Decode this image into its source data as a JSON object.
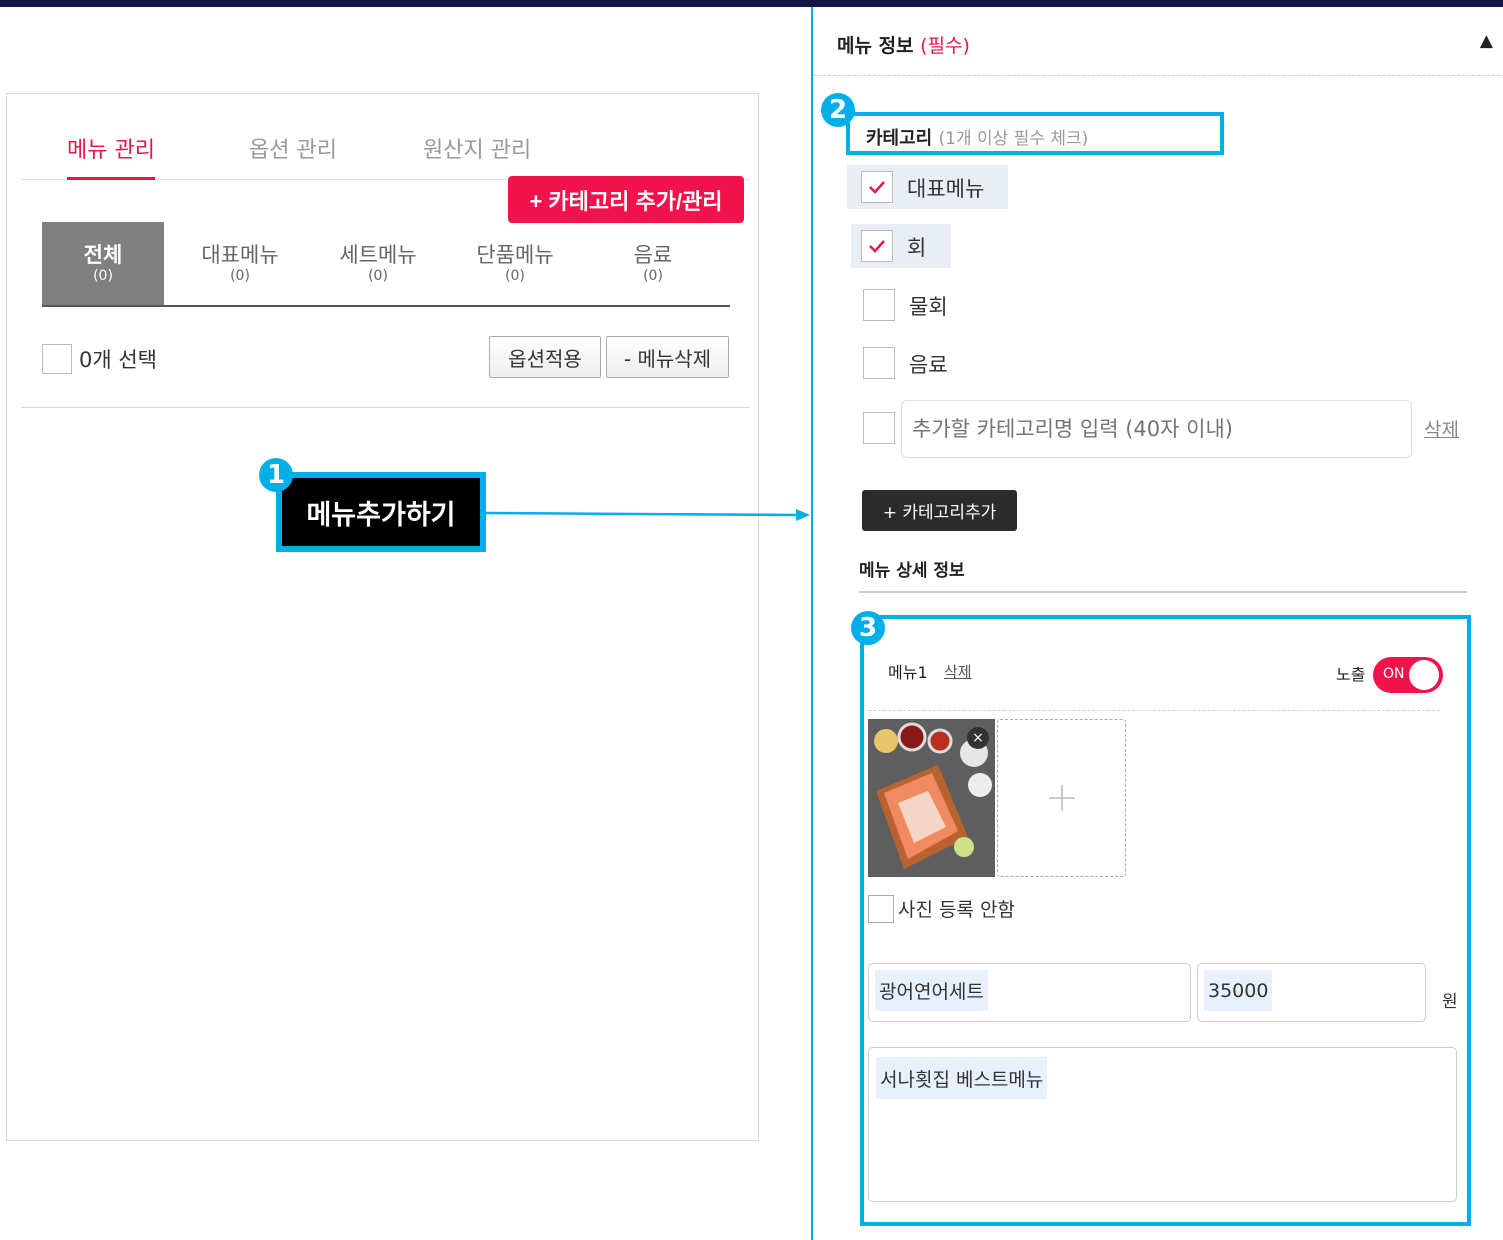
{
  "left": {
    "tabs": [
      {
        "label": "메뉴 관리",
        "active": true
      },
      {
        "label": "옵션 관리",
        "active": false
      },
      {
        "label": "원산지 관리",
        "active": false
      }
    ],
    "category_add_manage_label": "+ 카테고리 추가/관리",
    "subtabs": [
      {
        "name": "전체",
        "count": "(0)",
        "active": true
      },
      {
        "name": "대표메뉴",
        "count": "(0)",
        "active": false
      },
      {
        "name": "세트메뉴",
        "count": "(0)",
        "active": false
      },
      {
        "name": "단품메뉴",
        "count": "(0)",
        "active": false
      },
      {
        "name": "음료",
        "count": "(0)",
        "active": false
      }
    ],
    "selected_label": "0개 선택",
    "apply_option_label": "옵션적용",
    "delete_menu_label": "- 메뉴삭제",
    "add_menu_label": "메뉴추가하기"
  },
  "badges": [
    "1",
    "2",
    "3"
  ],
  "right": {
    "header_title": "메뉴 정보",
    "header_required": "(필수)",
    "collapse_glyph": "▲",
    "category_title": "카테고리",
    "category_hint": "(1개 이상 필수 체크)",
    "categories": [
      {
        "label": "대표메뉴",
        "checked": true
      },
      {
        "label": "회",
        "checked": true
      },
      {
        "label": "물회",
        "checked": false
      },
      {
        "label": "음료",
        "checked": false
      }
    ],
    "new_category_placeholder": "추가할 카테고리명 입력 (40자 이내)",
    "new_category_delete": "삭제",
    "add_category_label": "+ 카테고리추가",
    "detail_title": "메뉴 상세 정보",
    "menu": {
      "name": "메뉴1",
      "delete_label": "삭제",
      "expose_label": "노출",
      "expose_state": "ON",
      "photo_close": "×",
      "no_photo_label": "사진 등록 안함",
      "menu_name_value": "광어연어세트",
      "price_value": "35000",
      "currency": "원",
      "description_value": "서나횟집 베스트메뉴"
    }
  },
  "colors": {
    "accent_pink": "#f2134d",
    "highlight_blue": "#00aee8",
    "top_bar": "#15154a"
  }
}
